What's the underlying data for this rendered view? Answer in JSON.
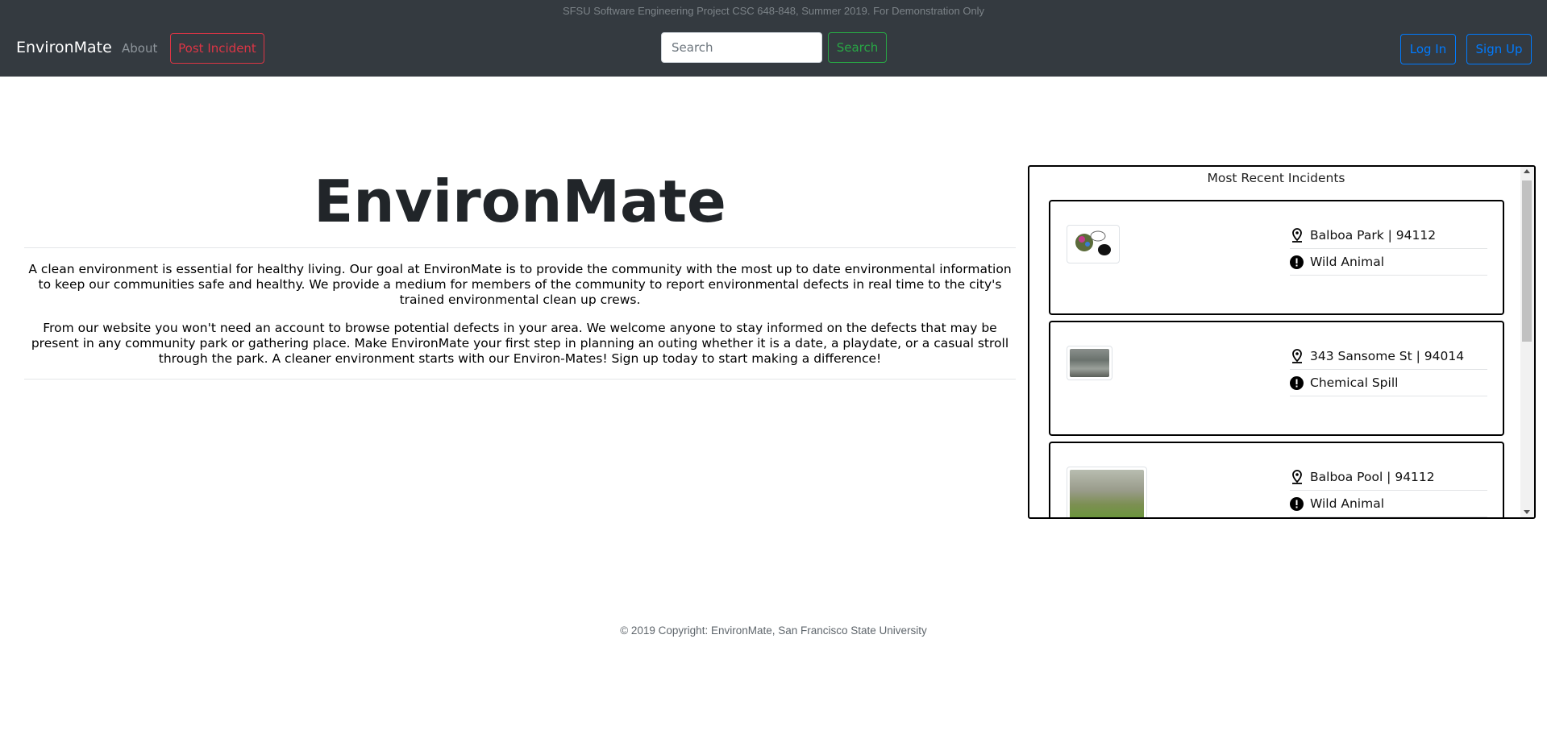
{
  "navbar": {
    "banner": "SFSU Software Engineering Project CSC 648-848, Summer 2019. For Demonstration Only",
    "brand": "EnvironMate",
    "about": "About",
    "post_incident": "Post Incident",
    "search_placeholder": "Search",
    "search_button": "Search",
    "login": "Log In",
    "signup": "Sign Up",
    "colors": {
      "background": "#343a40",
      "danger": "#dc3545",
      "success": "#28a745",
      "primary": "#007bff"
    }
  },
  "hero": {
    "title": "EnvironMate",
    "paragraph1": "A clean environment is essential for healthy living. Our goal at EnvironMate is to provide the community with the most up to date environmental information to keep our communities safe and healthy. We provide a medium for members of the community to report environmental defects in real time to the city's trained environmental clean up crews.",
    "paragraph2": "From our website you won't need an account to browse potential defects in your area. We welcome anyone to stay informed on the defects that may be present in any community park or gathering place. Make EnvironMate your first step in planning an outing whether it is a date, a playdate, or a casual stroll through the park. A cleaner environment starts with our Environ-Mates! Sign up today to start making a difference!"
  },
  "recent": {
    "title": "Most Recent Incidents",
    "incidents": [
      {
        "location": "Balboa Park | 94112",
        "type": "Wild Animal",
        "thumb_icon": "cartoon-animal-image"
      },
      {
        "location": "343 Sansome St | 94014",
        "type": "Chemical Spill",
        "thumb_icon": "water-spill-image"
      },
      {
        "location": "Balboa Pool | 94112",
        "type": "Wild Animal",
        "thumb_icon": "coyote-photo-image"
      }
    ],
    "icons": {
      "location": "map-pin-icon",
      "type": "exclamation-circle-icon"
    }
  },
  "footer": {
    "copyright": "© 2019 Copyright: EnvironMate, San Francisco State University"
  }
}
